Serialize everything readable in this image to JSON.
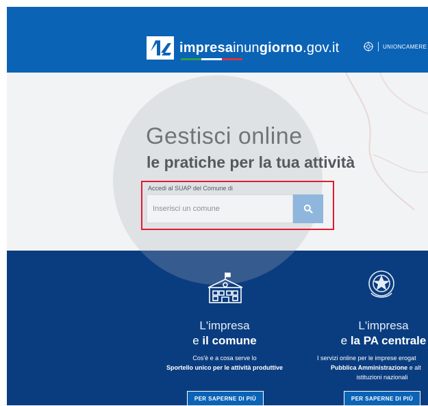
{
  "header": {
    "logo": {
      "part1": "impresa",
      "part2": "inun",
      "part3": "giorno",
      "part4": ".gov.it"
    },
    "partner_label": "UNIONCAMERE"
  },
  "hero": {
    "title_line1": "Gestisci online",
    "title_line2_start": "le pratiche per la tua atti",
    "title_line2_end": "vità",
    "search_label": "Accedi al SUAP del Comune di",
    "search_placeholder": "Inserisci un comune"
  },
  "columns": [
    {
      "title": "L'impresa",
      "sub_prefix": "e ",
      "sub_bold": "il comune",
      "line1": "Cos'è e a cosa serve lo",
      "line2_bold": "Sportello unico per le attività produttive",
      "button": "PER SAPERNE DI PIÙ"
    },
    {
      "title": "L'impresa",
      "sub_prefix": "e ",
      "sub_bold": "la PA centrale",
      "line1": "I servizi online per le imprese erogat",
      "line2_bold": "Pubblica Amministrazione",
      "line2_rest": " e alt",
      "line3": "istituzioni nazionali",
      "button": "PER SAPERNE DI PIÙ"
    }
  ],
  "colors": {
    "header_blue": "#0b63b6",
    "dark_blue": "#0a3d80",
    "highlight_red": "#e4182f",
    "search_button": "#8fb6dd"
  }
}
